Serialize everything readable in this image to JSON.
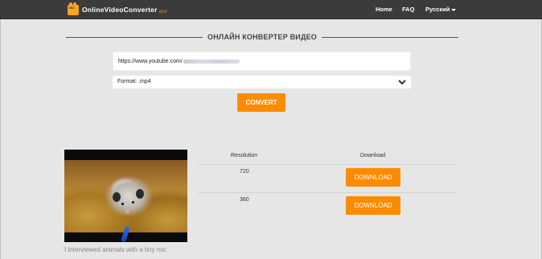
{
  "nav": {
    "brand_name": "OnlineVideoConverter",
    "brand_version": "v2.0",
    "logo_text": "ONC",
    "links": {
      "home": "Home",
      "faq": "FAQ",
      "language": "Русский"
    }
  },
  "converter": {
    "title": "ОНЛАЙН КОНВЕРТЕР ВИДЕО",
    "url_value": "https://www.youtube.com/",
    "format_value": "Format: .mp4",
    "convert_label": "CONVERT"
  },
  "results": {
    "headers": {
      "resolution": "Resolution",
      "download": "Download"
    },
    "rows": [
      {
        "resolution": "720",
        "download_label": "DOWNLOAD"
      },
      {
        "resolution": "360",
        "download_label": "DOWNLOAD"
      }
    ],
    "video_title": "I interviewed animals with a tiny mic"
  },
  "colors": {
    "accent": "#fb8c00",
    "navbar": "#3b3b3b",
    "background": "#e6e6e6"
  }
}
